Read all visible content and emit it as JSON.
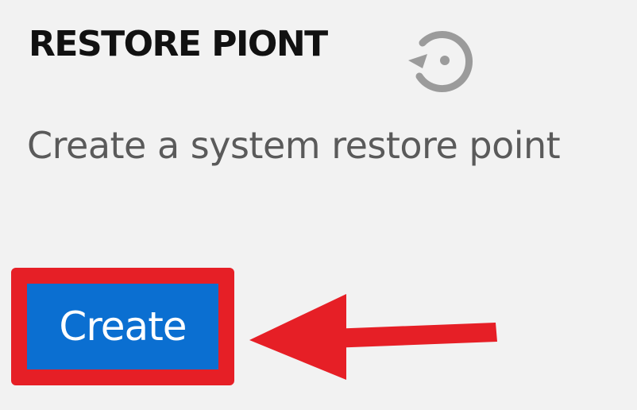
{
  "section": {
    "title": "RESTORE PIONT",
    "icon": "restore-icon",
    "description": "Create a system restore point"
  },
  "actions": {
    "create_label": "Create"
  },
  "annotation": {
    "highlight_color": "#e61f26",
    "arrow_color": "#e61f26",
    "arrow_icon": "arrow-left-icon"
  },
  "colors": {
    "panel_background": "#f2f2f2",
    "button_background": "#0b6fd1",
    "title_text": "#111111",
    "description_text": "#5a5a5a",
    "icon_gray": "#9b9b9b"
  }
}
